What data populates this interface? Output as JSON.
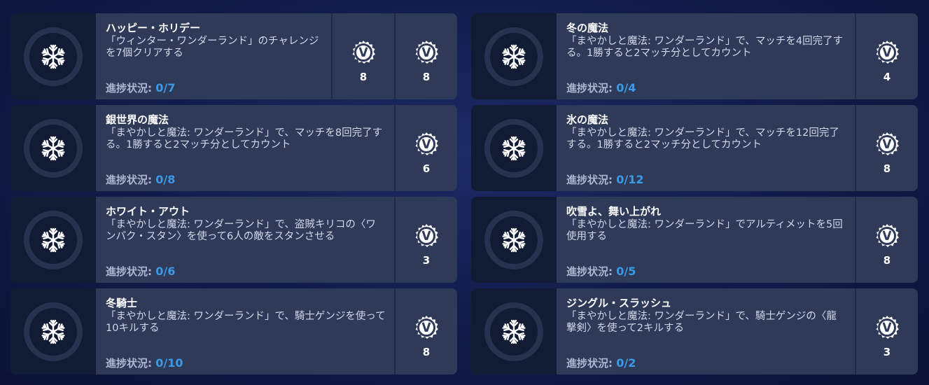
{
  "colors": {
    "card_bg": "#2e3a58",
    "icon_bg": "#121b34",
    "progress_value": "#3b9ae8",
    "page_bg": "#111a48"
  },
  "progress_label": "進捗状況:",
  "challenges": [
    {
      "title": "ハッピー・ホリデー",
      "description": "「ウィンター・ワンダーランド」のチャレンジを7個クリアする",
      "progress": "0/7",
      "icon": "snowflake-icon",
      "rewards": [
        {
          "icon": "overwatch-coin-icon",
          "count": "8"
        },
        {
          "icon": "overwatch-coin-icon",
          "count": "8"
        }
      ]
    },
    {
      "title": "冬の魔法",
      "description": "「まやかしと魔法: ワンダーランド」で、マッチを4回完了する。1勝すると2マッチ分としてカウント",
      "progress": "0/4",
      "icon": "snowflake-icon",
      "rewards": [
        {
          "icon": "overwatch-coin-icon",
          "count": "4"
        }
      ]
    },
    {
      "title": "銀世界の魔法",
      "description": "「まやかしと魔法: ワンダーランド」で、マッチを8回完了する。1勝すると2マッチ分としてカウント",
      "progress": "0/8",
      "icon": "snowflake-icon",
      "rewards": [
        {
          "icon": "overwatch-coin-icon",
          "count": "6"
        }
      ]
    },
    {
      "title": "氷の魔法",
      "description": "「まやかしと魔法: ワンダーランド」で、マッチを12回完了する。1勝すると2マッチ分としてカウント",
      "progress": "0/12",
      "icon": "snowflake-icon",
      "rewards": [
        {
          "icon": "overwatch-coin-icon",
          "count": "8"
        }
      ]
    },
    {
      "title": "ホワイト・アウト",
      "description": "「まやかしと魔法: ワンダーランド」で、盗賊キリコの〈ワンパク・スタン〉を使って6人の敵をスタンさせる",
      "progress": "0/6",
      "icon": "snowflake-icon",
      "rewards": [
        {
          "icon": "overwatch-coin-icon",
          "count": "3"
        }
      ]
    },
    {
      "title": "吹雪よ、舞い上がれ",
      "description": "「まやかしと魔法: ワンダーランド」でアルティメットを5回使用する",
      "progress": "0/5",
      "icon": "snowflake-icon",
      "rewards": [
        {
          "icon": "overwatch-coin-icon",
          "count": "8"
        }
      ]
    },
    {
      "title": "冬騎士",
      "description": "「まやかしと魔法: ワンダーランド」で、騎士ゲンジを使って10キルする",
      "progress": "0/10",
      "icon": "snowflake-icon",
      "rewards": [
        {
          "icon": "overwatch-coin-icon",
          "count": "8"
        }
      ]
    },
    {
      "title": "ジングル・スラッシュ",
      "description": "「まやかしと魔法: ワンダーランド」で、騎士ゲンジの〈龍撃剣〉を使って2キルする",
      "progress": "0/2",
      "icon": "snowflake-icon",
      "rewards": [
        {
          "icon": "overwatch-coin-icon",
          "count": "3"
        }
      ]
    }
  ]
}
